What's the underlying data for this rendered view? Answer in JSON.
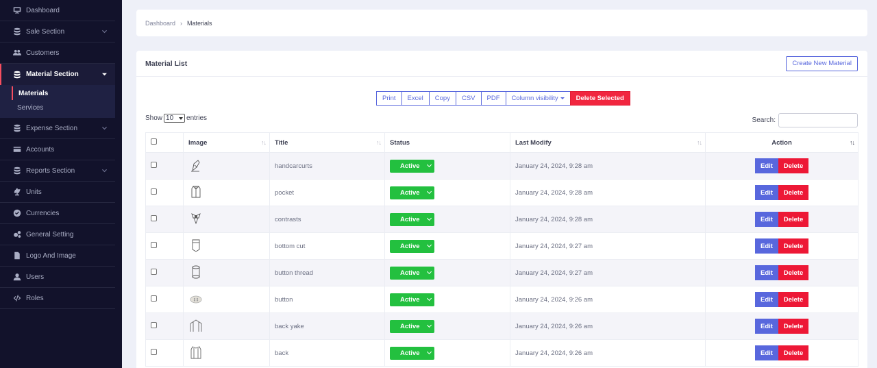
{
  "sidebar": {
    "items": [
      {
        "label": "Dashboard",
        "icon": "monitor-icon"
      },
      {
        "label": "Sale Section",
        "icon": "database-icon"
      },
      {
        "label": "Customers",
        "icon": "users-icon"
      },
      {
        "label": "Material Section",
        "icon": "database-icon"
      },
      {
        "label": "Expense Section",
        "icon": "database-icon"
      },
      {
        "label": "Accounts",
        "icon": "credit-card-icon"
      },
      {
        "label": "Reports Section",
        "icon": "database-icon"
      },
      {
        "label": "Units",
        "icon": "balance-scale-icon"
      },
      {
        "label": "Currencies",
        "icon": "check-circle-icon"
      },
      {
        "label": "General Setting",
        "icon": "cogs-icon"
      },
      {
        "label": "Logo And Image",
        "icon": "file-icon"
      },
      {
        "label": "Users",
        "icon": "user-icon"
      },
      {
        "label": "Roles",
        "icon": "code-icon"
      }
    ],
    "submenu": [
      {
        "label": "Materials"
      },
      {
        "label": "Services"
      }
    ]
  },
  "breadcrumb": {
    "root": "Dashboard",
    "current": "Materials"
  },
  "card": {
    "title": "Material List",
    "create_label": "Create New Material"
  },
  "export": {
    "print": "Print",
    "excel": "Excel",
    "copy": "Copy",
    "csv": "CSV",
    "pdf": "PDF",
    "colvis": "Column visibility",
    "delete_selected": "Delete Selected"
  },
  "length": {
    "show": "Show",
    "value": "10",
    "entries": "entries"
  },
  "search": {
    "label": "Search:"
  },
  "table": {
    "headers": {
      "image": "Image",
      "title": "Title",
      "status": "Status",
      "last_modify": "Last Modify",
      "action": "Action"
    },
    "edit_label": "Edit",
    "delete_label": "Delete",
    "rows": [
      {
        "title": "handcarcurts",
        "status": "Active",
        "date": "January 24, 2024, 9:28 am"
      },
      {
        "title": "pocket",
        "status": "Active",
        "date": "January 24, 2024, 9:28 am"
      },
      {
        "title": "contrasts",
        "status": "Active",
        "date": "January 24, 2024, 9:28 am"
      },
      {
        "title": "bottom cut",
        "status": "Active",
        "date": "January 24, 2024, 9:27 am"
      },
      {
        "title": "button thread",
        "status": "Active",
        "date": "January 24, 2024, 9:27 am"
      },
      {
        "title": "button",
        "status": "Active",
        "date": "January 24, 2024, 9:26 am"
      },
      {
        "title": "back yake",
        "status": "Active",
        "date": "January 24, 2024, 9:26 am"
      },
      {
        "title": "back",
        "status": "Active",
        "date": "January 24, 2024, 9:26 am"
      }
    ]
  },
  "colors": {
    "sidebar_bg": "#12122b",
    "primary": "#5867dd",
    "danger": "#ed1836",
    "success": "#23c03f"
  }
}
